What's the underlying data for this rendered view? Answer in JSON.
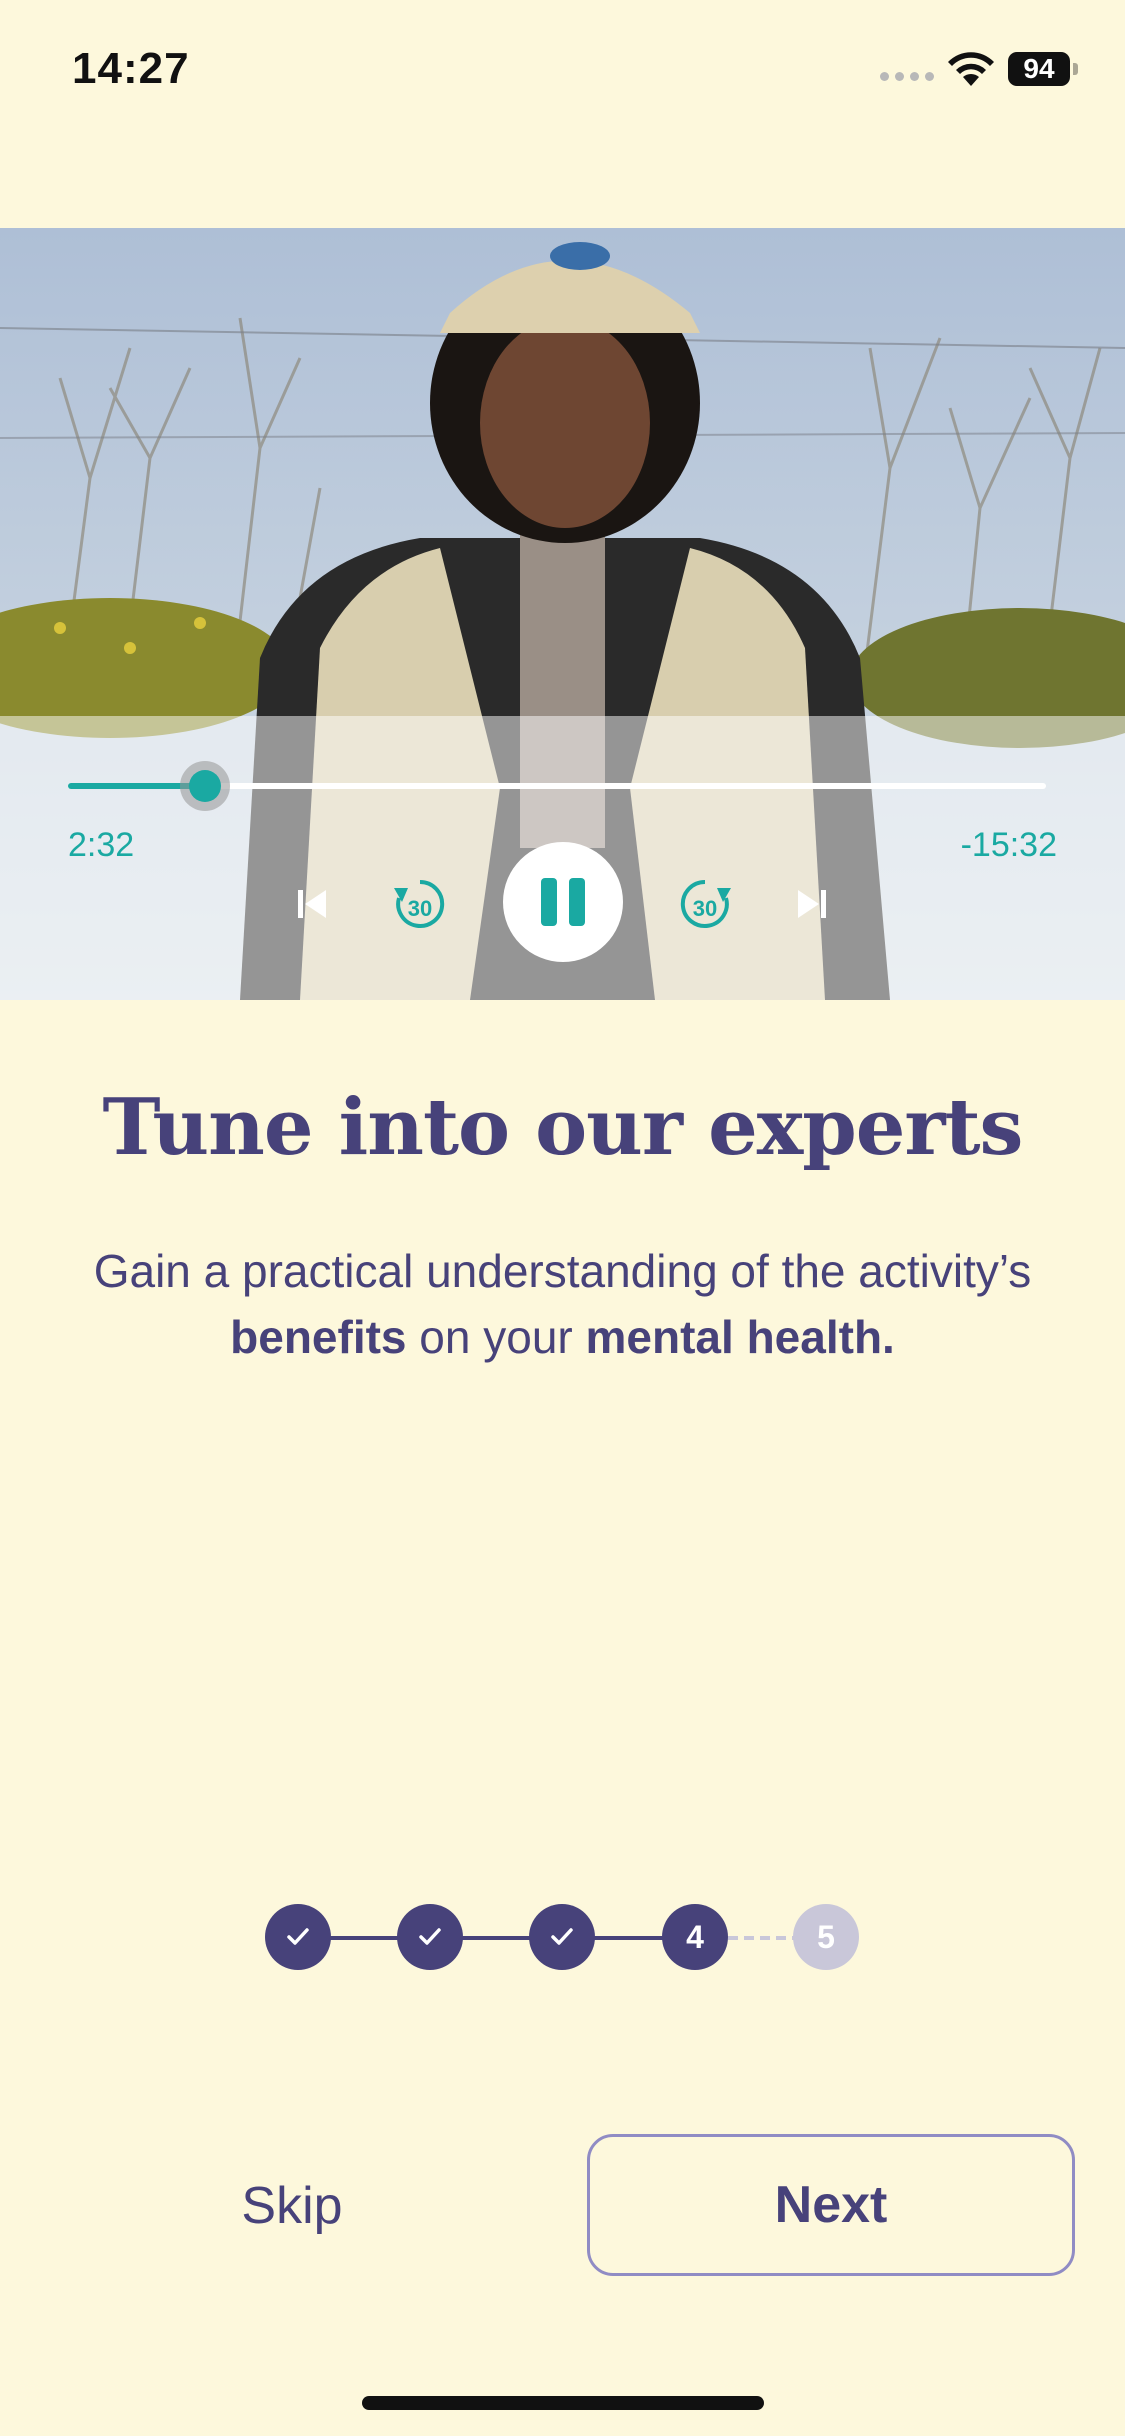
{
  "status_bar": {
    "time": "14:27",
    "battery": "94"
  },
  "player": {
    "elapsed": "2:32",
    "remaining": "-15:32",
    "progress": 0.14,
    "skip_back_seconds": "30",
    "skip_forward_seconds": "30",
    "accent_color": "#1aa9a2"
  },
  "content": {
    "title": "Tune into our experts",
    "subtitle_part1": "Gain a practical understanding of the activity’s ",
    "subtitle_bold1": "benefits",
    "subtitle_part2": " on your ",
    "subtitle_bold2": "mental health."
  },
  "stepper": {
    "current_step": "4",
    "next_step": "5",
    "completed_steps": 3,
    "total_steps": 5
  },
  "actions": {
    "skip_label": "Skip",
    "next_label": "Next"
  },
  "colors": {
    "background": "#fdf8dc",
    "primary": "#47427a",
    "accent": "#1aa9a2",
    "inactive": "#c9c7d9"
  }
}
